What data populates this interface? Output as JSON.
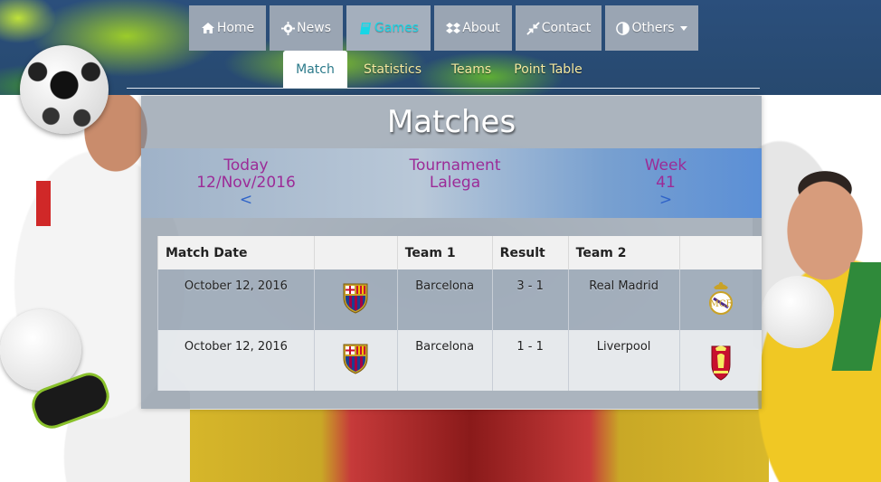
{
  "nav": {
    "items": [
      {
        "id": "home",
        "label": "Home",
        "icon": "home-icon"
      },
      {
        "id": "news",
        "label": "News",
        "icon": "gear-icon"
      },
      {
        "id": "games",
        "label": "Games",
        "icon": "book-icon",
        "active": true
      },
      {
        "id": "about",
        "label": "About",
        "icon": "dropbox-icon"
      },
      {
        "id": "contact",
        "label": "Contact",
        "icon": "shrink-arrows-icon"
      },
      {
        "id": "others",
        "label": "Others",
        "icon": "contrast-icon",
        "dropdown": true
      }
    ],
    "active_color": "#18d6e6"
  },
  "subnav": {
    "items": [
      "Match",
      "Statistics",
      "Teams",
      "Point Table"
    ],
    "active": "Match"
  },
  "panel": {
    "title": "Matches",
    "today": {
      "label": "Today",
      "date": "12/Nov/2016",
      "prev": "<"
    },
    "tournament": {
      "label": "Tournament",
      "name": "Lalega"
    },
    "week": {
      "label": "Week",
      "number": "41",
      "next": ">"
    }
  },
  "table": {
    "headers": [
      "Match Date",
      "",
      "Team 1",
      "Result",
      "Team 2",
      ""
    ],
    "rows": [
      {
        "date": "October 12, 2016",
        "team1": "Barcelona",
        "team1_icon": "barcelona-crest-icon",
        "result": "3 - 1",
        "team2": "Real Madrid",
        "team2_icon": "real-madrid-crest-icon"
      },
      {
        "date": "October 12, 2016",
        "team1": "Barcelona",
        "team1_icon": "barcelona-crest-icon",
        "result": "1 - 1",
        "team2": "Liverpool",
        "team2_icon": "liverpool-crest-icon"
      }
    ]
  },
  "colors": {
    "header_bg": "#2b4f7c",
    "nav_bg": "#9aa5b3",
    "info_text": "#9c2b97",
    "arrow": "#2f63c8",
    "subnav_text": "#f5e9a0"
  }
}
